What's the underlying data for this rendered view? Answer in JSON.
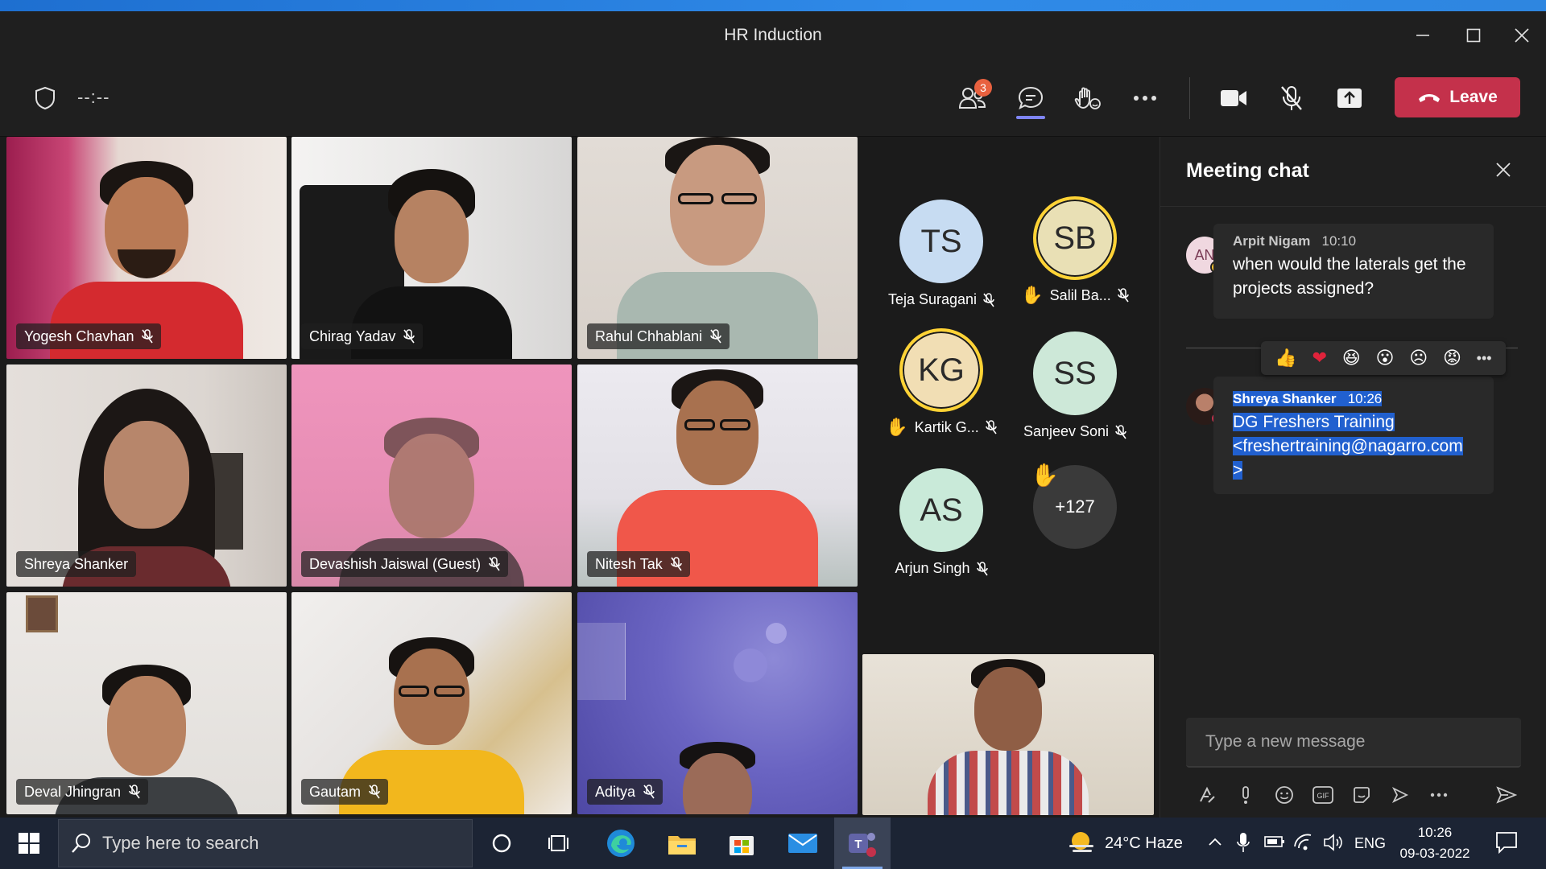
{
  "window": {
    "title": "HR Induction"
  },
  "toolbar": {
    "timer": "--:--",
    "participants_badge": "3",
    "leave_label": "Leave"
  },
  "tiles": [
    {
      "name": "Yogesh Chavhan"
    },
    {
      "name": "Chirag Yadav"
    },
    {
      "name": "Rahul Chhablani"
    },
    {
      "name": "Shreya Shanker"
    },
    {
      "name": "Devashish Jaiswal (Guest)"
    },
    {
      "name": "Nitesh Tak"
    },
    {
      "name": "Deval Jhingran"
    },
    {
      "name": "Gautam"
    },
    {
      "name": "Aditya"
    }
  ],
  "avatars": [
    {
      "initials": "TS",
      "name": "Teja Suragani",
      "color": "#c7dcf2"
    },
    {
      "initials": "SB",
      "name": "Salil Ba...",
      "color": "#e9e0b5"
    },
    {
      "initials": "KG",
      "name": "Kartik G...",
      "color": "#f1deb4"
    },
    {
      "initials": "SS",
      "name": "Sanjeev Soni",
      "color": "#cde8d8"
    },
    {
      "initials": "AS",
      "name": "Arjun Singh",
      "color": "#c9ead9"
    }
  ],
  "overflow_count": "+127",
  "chat": {
    "title": "Meeting chat",
    "messages": [
      {
        "initials": "AN",
        "sender": "Arpit Nigam",
        "time": "10:10",
        "text": "when would the laterals get the projects assigned?"
      },
      {
        "sender": "Shreya Shanker",
        "time": "10:26",
        "line1": "DG Freshers Training",
        "line2": "<freshertraining@nagarro.com",
        "line3": ">"
      }
    ],
    "compose_placeholder": "Type a new message"
  },
  "taskbar": {
    "search_placeholder": "Type here to search",
    "weather": "24°C  Haze",
    "language": "ENG",
    "time": "10:26",
    "date": "09-03-2022"
  },
  "colors": {
    "leave": "#c4314b",
    "accent": "#7f85f5",
    "badge": "#e8613f",
    "highlight": "#2160cf"
  }
}
